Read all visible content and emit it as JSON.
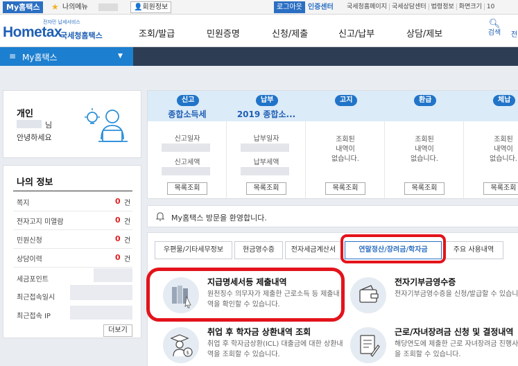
{
  "topbar": {
    "home_label": "My홈택스",
    "mymenu_label": "나의메뉴",
    "member_label": "회원정보",
    "logout_label": "로그아웃",
    "cert_label": "인증센터",
    "links": [
      "국세청홈페이지",
      "국세상담센터",
      "법령정보",
      "화면크기",
      "10"
    ]
  },
  "header": {
    "logo_tagline": "전자민 납세서비스",
    "logo_main": "Hometax",
    "logo_sub": "국세청홈택스",
    "gnb": [
      "조회/발급",
      "민원증명",
      "신청/제출",
      "신고/납부",
      "상담/제보"
    ],
    "search_label": "검색",
    "extra_label": "전"
  },
  "navbar": {
    "title": "My홈택스"
  },
  "profile": {
    "type": "개인",
    "name_suffix": "님",
    "greeting": "안녕하세요"
  },
  "myinfo": {
    "title": "나의 정보",
    "rows": [
      {
        "label": "쪽지",
        "count": "0",
        "unit": "건"
      },
      {
        "label": "전자고지 미열람",
        "count": "0",
        "unit": "건"
      },
      {
        "label": "민원신청",
        "count": "0",
        "unit": "건"
      },
      {
        "label": "상담이력",
        "count": "0",
        "unit": "건"
      }
    ],
    "points_label": "세금포인트",
    "last_login_label": "최근접속일시",
    "last_ip_label": "최근접속 IP",
    "more_label": "더보기"
  },
  "status": {
    "columns": [
      {
        "badge": "신고",
        "title": "종합소득세",
        "lab1": "신고일자",
        "lab2": "신고세액",
        "button": "목록조회"
      },
      {
        "badge": "납부",
        "title": "2019 종합소...",
        "lab1": "납부일자",
        "lab2": "납부세액",
        "button": "목록조회"
      },
      {
        "badge": "고지",
        "empty1": "조회된",
        "empty2": "내역이",
        "empty3": "없습니다.",
        "button": "목록조회"
      },
      {
        "badge": "환급",
        "empty1": "조회된",
        "empty2": "내역이",
        "empty3": "없습니다.",
        "button": "목록조회"
      },
      {
        "badge": "체납",
        "empty1": "조회된",
        "empty2": "내역이",
        "empty3": "없습니다.",
        "button": "목록조회"
      }
    ]
  },
  "welcome": {
    "text": "My홈택스 방문을 환영합니다."
  },
  "tabs": [
    {
      "label": "우편물/기타세무정보"
    },
    {
      "label": "현금영수증"
    },
    {
      "label": "전자세금계산서"
    },
    {
      "label": "연말정산/장려금/학자금"
    },
    {
      "label": "주요 사용내역"
    }
  ],
  "services": [
    {
      "title": "지급명세서등 제출내역",
      "desc": "원천징수 의무자가 제출한 근로소득 등 제출내역을 확인할 수 있습니다."
    },
    {
      "title": "전자기부금영수증",
      "desc": "전자기부금영수증을 신청/발급할 수 있습니다."
    },
    {
      "title": "취업 후 학자금 상환내역 조회",
      "desc": "취업 후 학자금상환(ICL) 대출금에 대한 상환내역을 조회할 수 있습니다."
    },
    {
      "title": "근로/자녀장려금 신청 및 결정내역",
      "desc": "해당연도에 제출한 근로 자녀장려금 진행사항을 조회할 수 있습니다."
    }
  ],
  "colors": {
    "brand_blue": "#1f5fb4",
    "nav_dark": "#2d3e54",
    "my_blue": "#1d7fcf",
    "badge_blue": "#2174c8",
    "count_red": "#e02121",
    "highlight_red": "#e3131b"
  },
  "icons": {
    "star": "star-icon",
    "member": "person-icon",
    "search": "search-icon",
    "menu": "hamburger-icon",
    "caret": "caret-down-icon",
    "profile": "person-idea-icon",
    "bell": "bell-icon"
  }
}
